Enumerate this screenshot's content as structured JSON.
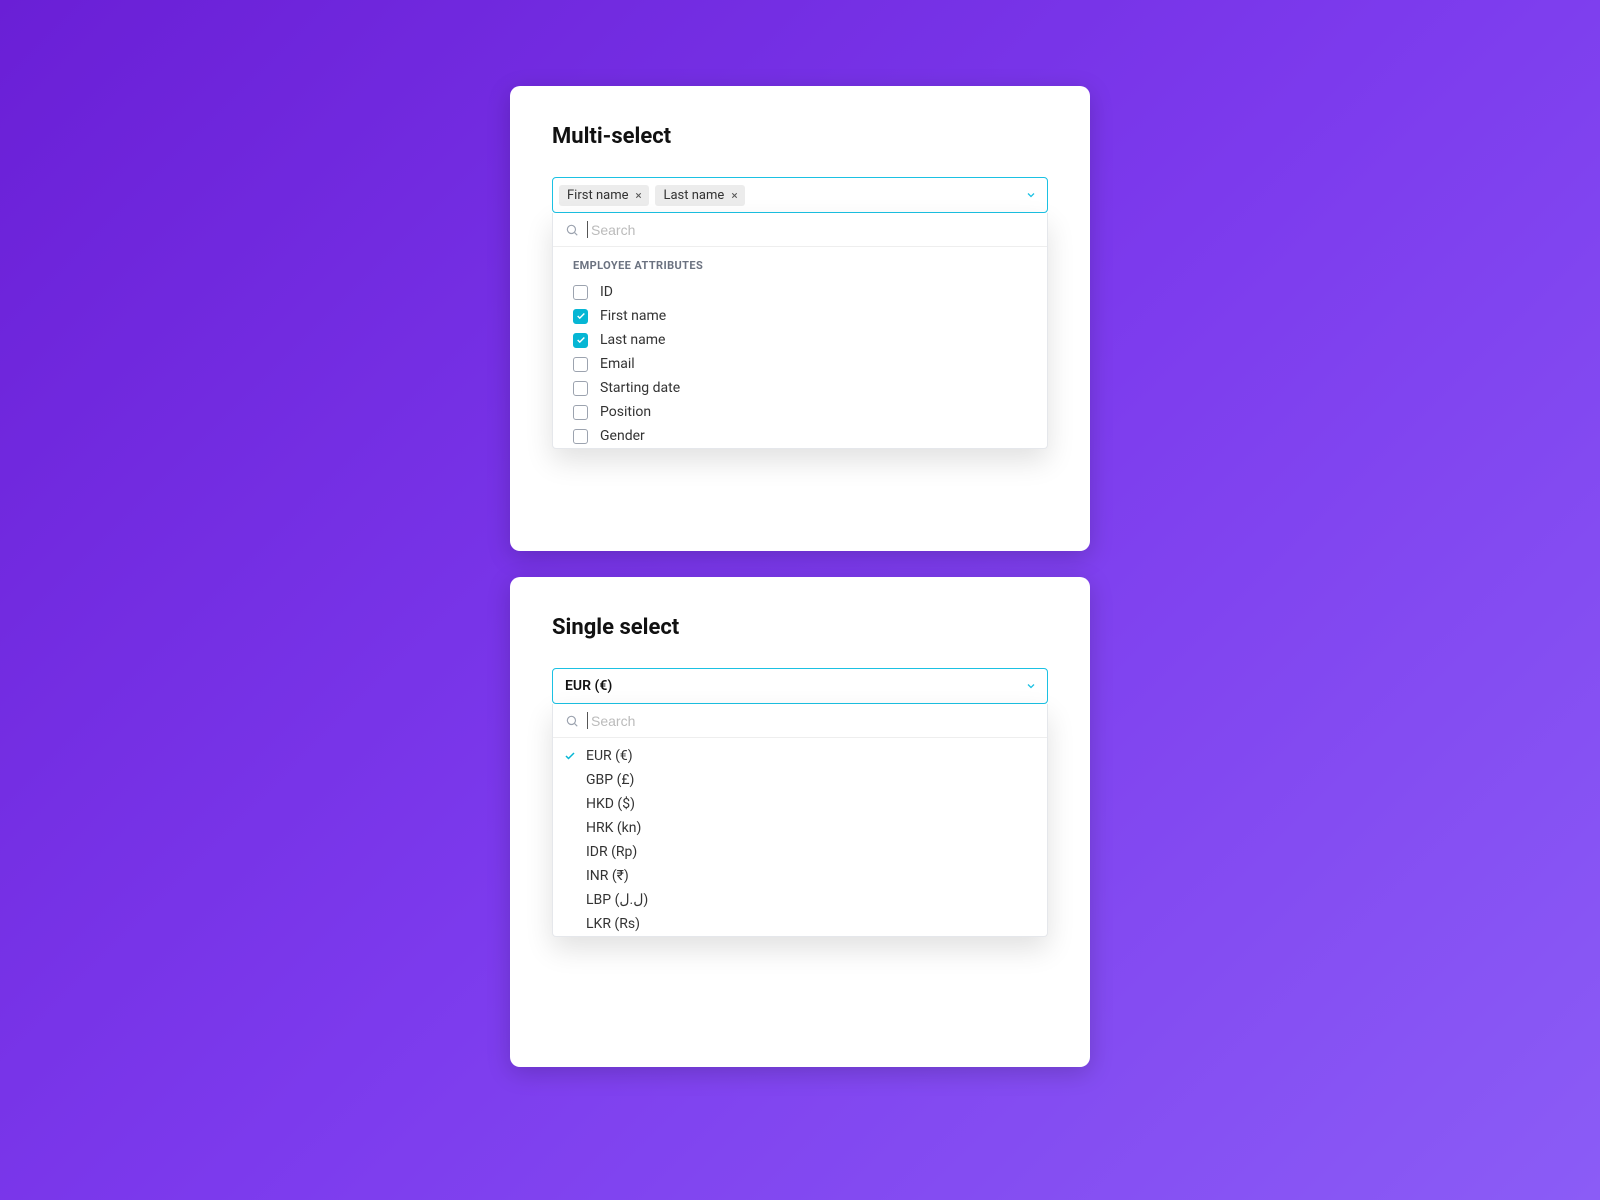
{
  "multi_select": {
    "title": "Multi-select",
    "search_placeholder": "Search",
    "group_label": "EMPLOYEE ATTRIBUTES",
    "chips": [
      {
        "label": "First name"
      },
      {
        "label": "Last name"
      }
    ],
    "options": [
      {
        "label": "ID",
        "checked": false
      },
      {
        "label": "First name",
        "checked": true
      },
      {
        "label": "Last name",
        "checked": true
      },
      {
        "label": "Email",
        "checked": false
      },
      {
        "label": "Starting date",
        "checked": false
      },
      {
        "label": "Position",
        "checked": false
      },
      {
        "label": "Gender",
        "checked": false
      }
    ]
  },
  "single_select": {
    "title": "Single select",
    "search_placeholder": "Search",
    "selected_value": "EUR (€)",
    "options": [
      {
        "label": "EUR (€)",
        "selected": true
      },
      {
        "label": "GBP (£)",
        "selected": false
      },
      {
        "label": "HKD ($)",
        "selected": false
      },
      {
        "label": "HRK (kn)",
        "selected": false
      },
      {
        "label": "IDR (Rp)",
        "selected": false
      },
      {
        "label": "INR (₹)",
        "selected": false
      },
      {
        "label": "LBP (ل.ل)",
        "selected": false
      },
      {
        "label": "LKR (Rs)",
        "selected": false
      }
    ]
  }
}
